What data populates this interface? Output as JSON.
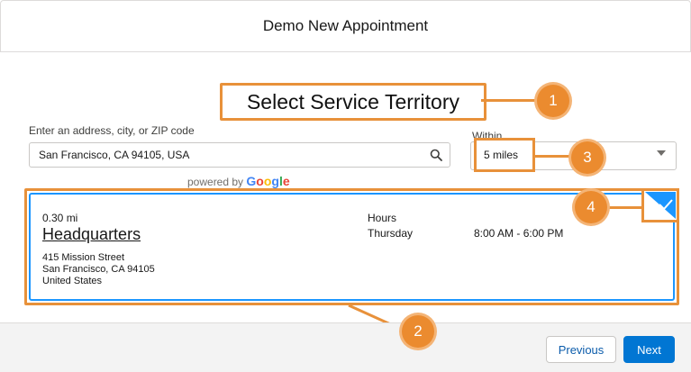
{
  "header": {
    "title": "Demo New Appointment"
  },
  "page_title": "Select Service Territory",
  "address": {
    "label": "Enter an address, city, or ZIP code",
    "value": "San Francisco, CA 94105, USA"
  },
  "powered_by": {
    "prefix": "powered by",
    "brand": "Google"
  },
  "within": {
    "label": "Within",
    "selected": "5 miles"
  },
  "territory": {
    "distance": "0.30 mi",
    "name": "Headquarters",
    "address_lines": [
      "415 Mission Street",
      "San Francisco, CA 94105",
      "United States"
    ],
    "hours_label": "Hours",
    "hours_day": "Thursday",
    "hours_time": "8:00 AM - 6:00 PM",
    "selected": true
  },
  "callouts": [
    "1",
    "2",
    "3",
    "4"
  ],
  "footer": {
    "previous_label": "Previous",
    "next_label": "Next"
  },
  "colors": {
    "callout": "#eb8b2f",
    "selection_border": "#1b96ff",
    "primary_button": "#0176d3",
    "google": [
      "#4285f4",
      "#ea4335",
      "#fbbc05",
      "#4285f4",
      "#34a853",
      "#ea4335"
    ]
  },
  "icons": {
    "search": "search-icon",
    "dropdown": "chevron-down-icon",
    "check": "check-icon"
  }
}
